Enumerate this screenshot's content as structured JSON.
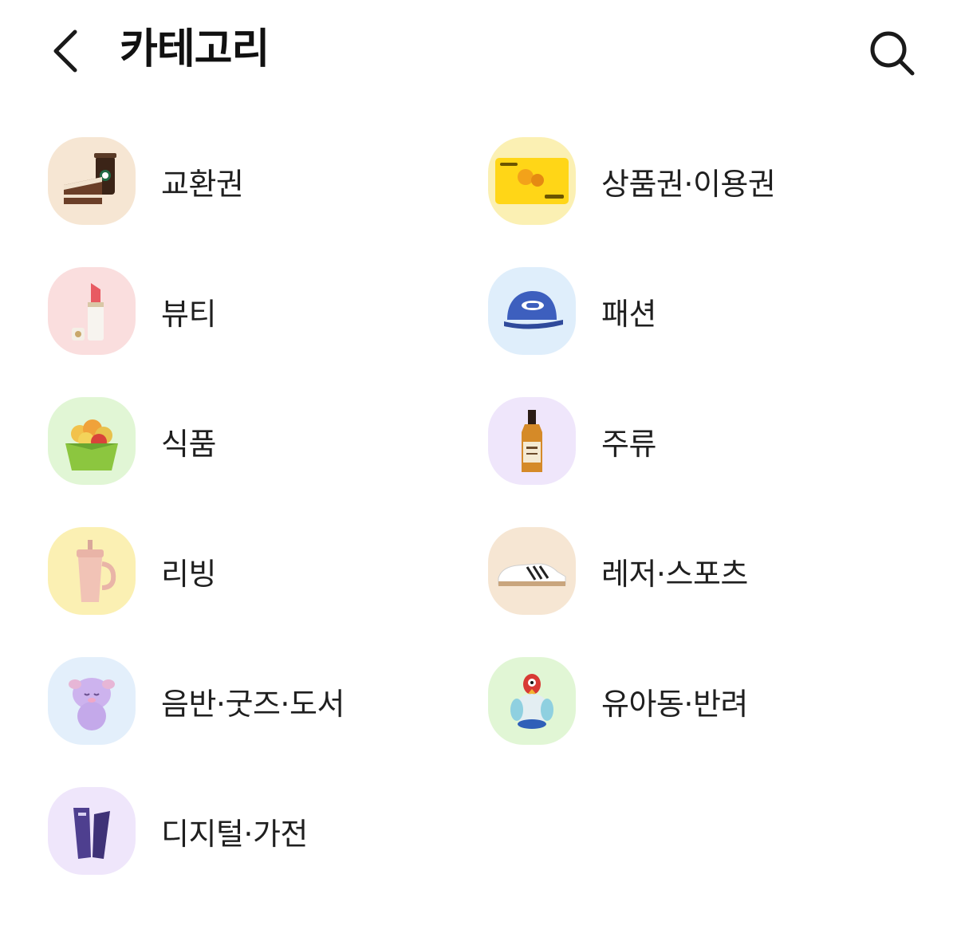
{
  "header": {
    "title": "카테고리"
  },
  "categories": [
    {
      "label": "교환권",
      "icon": "cake-coffee-icon",
      "bg": "#f6e6d3"
    },
    {
      "label": "상품권·이용권",
      "icon": "gift-card-icon",
      "bg": "#fbf0b3"
    },
    {
      "label": "뷰티",
      "icon": "lipstick-icon",
      "bg": "#fadede"
    },
    {
      "label": "패션",
      "icon": "cap-icon",
      "bg": "#dfeefb"
    },
    {
      "label": "식품",
      "icon": "fruit-box-icon",
      "bg": "#e1f6d5"
    },
    {
      "label": "주류",
      "icon": "whisky-bottle-icon",
      "bg": "#efe6fb"
    },
    {
      "label": "리빙",
      "icon": "tumbler-icon",
      "bg": "#fbf0b3"
    },
    {
      "label": "레저·스포츠",
      "icon": "sneaker-icon",
      "bg": "#f6e6d3"
    },
    {
      "label": "음반·굿즈·도서",
      "icon": "plush-doll-icon",
      "bg": "#e3effb"
    },
    {
      "label": "유아동·반려",
      "icon": "parrot-toy-icon",
      "bg": "#e1f6d5"
    },
    {
      "label": "디지털·가전",
      "icon": "purple-device-icon",
      "bg": "#efe6fb"
    }
  ]
}
